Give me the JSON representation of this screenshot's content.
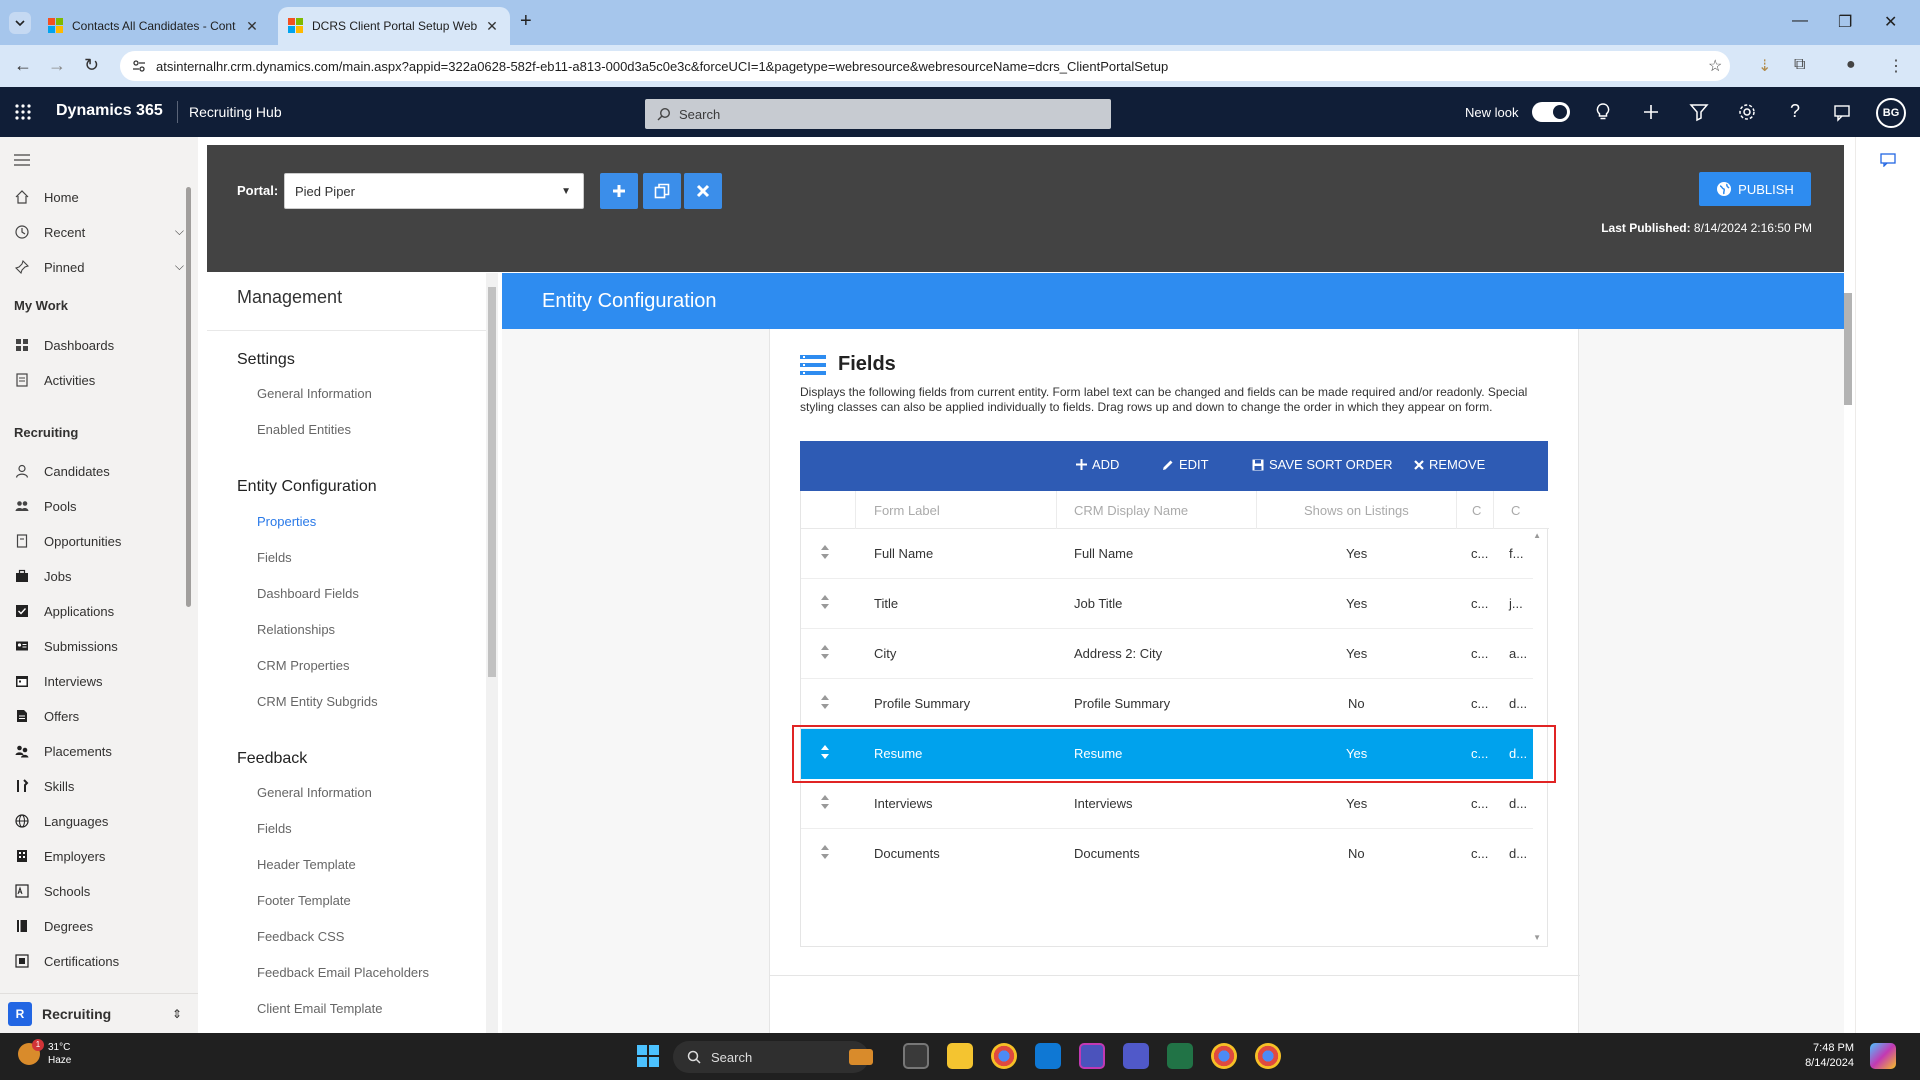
{
  "browser": {
    "tabs": [
      {
        "label": "Contacts All Candidates - Cont",
        "active": false
      },
      {
        "label": "DCRS Client Portal Setup Web",
        "active": true
      }
    ],
    "url": "atsinternalhr.crm.dynamics.com/main.aspx?appid=322a0628-582f-eb11-a813-000d3a5c0e3c&forceUCI=1&pagetype=webresource&webresourceName=dcrs_ClientPortalSetup"
  },
  "d365": {
    "title": "Dynamics 365",
    "app_name": "Recruiting Hub",
    "search_placeholder": "Search",
    "new_look_label": "New look",
    "avatar_initials": "BG"
  },
  "sitemap": {
    "top_items": [
      {
        "label": "Home",
        "icon": "home-icon"
      },
      {
        "label": "Recent",
        "icon": "clock-icon"
      },
      {
        "label": "Pinned",
        "icon": "pin-icon"
      }
    ],
    "my_work": {
      "title": "My Work",
      "items": [
        {
          "label": "Dashboards",
          "icon": "dashboard-icon"
        },
        {
          "label": "Activities",
          "icon": "clipboard-icon"
        }
      ]
    },
    "recruiting": {
      "title": "Recruiting",
      "items": [
        {
          "label": "Candidates",
          "icon": "person-icon"
        },
        {
          "label": "Pools",
          "icon": "people-icon"
        },
        {
          "label": "Opportunities",
          "icon": "document-icon"
        },
        {
          "label": "Jobs",
          "icon": "briefcase-icon"
        },
        {
          "label": "Applications",
          "icon": "checklist-icon"
        },
        {
          "label": "Submissions",
          "icon": "id-card-icon"
        },
        {
          "label": "Interviews",
          "icon": "calendar-icon"
        },
        {
          "label": "Offers",
          "icon": "document-icon"
        },
        {
          "label": "Placements",
          "icon": "people-icon"
        },
        {
          "label": "Skills",
          "icon": "tools-icon"
        },
        {
          "label": "Languages",
          "icon": "globe-icon"
        },
        {
          "label": "Employers",
          "icon": "building-icon"
        },
        {
          "label": "Schools",
          "icon": "abc-icon"
        },
        {
          "label": "Degrees",
          "icon": "book-icon"
        },
        {
          "label": "Certifications",
          "icon": "certificate-icon"
        }
      ]
    },
    "area": {
      "letter": "R",
      "label": "Recruiting"
    }
  },
  "portal": {
    "label": "Portal:",
    "selected": "Pied Piper",
    "publish_label": "PUBLISH",
    "last_published_label": "Last Published:",
    "last_published_value": "8/14/2024 2:16:50 PM"
  },
  "management": {
    "title": "Management",
    "sections": [
      {
        "title": "Settings",
        "links": [
          "General Information",
          "Enabled Entities"
        ]
      },
      {
        "title": "Entity Configuration",
        "links": [
          "Properties",
          "Fields",
          "Dashboard Fields",
          "Relationships",
          "CRM Properties",
          "CRM Entity Subgrids"
        ],
        "active_link": "Properties"
      },
      {
        "title": "Feedback",
        "links": [
          "General Information",
          "Fields",
          "Header Template",
          "Footer Template",
          "Feedback CSS",
          "Feedback Email Placeholders",
          "Client Email Template"
        ]
      }
    ]
  },
  "entity_config": {
    "title": "Entity Configuration",
    "fields_title": "Fields",
    "description": "Displays the following fields from current entity. Form label text can be changed and fields can be made required and/or readonly. Special styling classes can also be applied individually to fields. Drag rows up and down to change the order in which they appear on form.",
    "toolbar": {
      "add": "ADD",
      "edit": "EDIT",
      "save_sort": "SAVE SORT ORDER",
      "remove": "REMOVE"
    },
    "columns": [
      "Form Label",
      "CRM Display Name",
      "Shows on Listings",
      "C",
      "C"
    ],
    "rows": [
      {
        "form_label": "Full Name",
        "crm_name": "Full Name",
        "listings": "Yes",
        "c1": "c...",
        "c2": "f..."
      },
      {
        "form_label": "Title",
        "crm_name": "Job Title",
        "listings": "Yes",
        "c1": "c...",
        "c2": "j..."
      },
      {
        "form_label": "City",
        "crm_name": "Address 2: City",
        "listings": "Yes",
        "c1": "c...",
        "c2": "a..."
      },
      {
        "form_label": "Profile Summary",
        "crm_name": "Profile Summary",
        "listings": "No",
        "c1": "c...",
        "c2": "d..."
      },
      {
        "form_label": "Resume",
        "crm_name": "Resume",
        "listings": "Yes",
        "c1": "c...",
        "c2": "d...",
        "selected": true
      },
      {
        "form_label": "Interviews",
        "crm_name": "Interviews",
        "listings": "Yes",
        "c1": "c...",
        "c2": "d..."
      },
      {
        "form_label": "Documents",
        "crm_name": "Documents",
        "listings": "No",
        "c1": "c...",
        "c2": "d..."
      }
    ]
  },
  "taskbar": {
    "weather_temp": "31°C",
    "weather_desc": "Haze",
    "weather_badge": "1",
    "search_label": "Search",
    "time": "7:48 PM",
    "date": "8/14/2024"
  },
  "colors": {
    "d365_bar": "#101e37",
    "portal_header": "#434343",
    "accent_blue": "#2e8cf0",
    "grid_toolbar": "#2e5bb4",
    "selected_row": "#00a2ed",
    "highlight_outline": "#e02424"
  }
}
